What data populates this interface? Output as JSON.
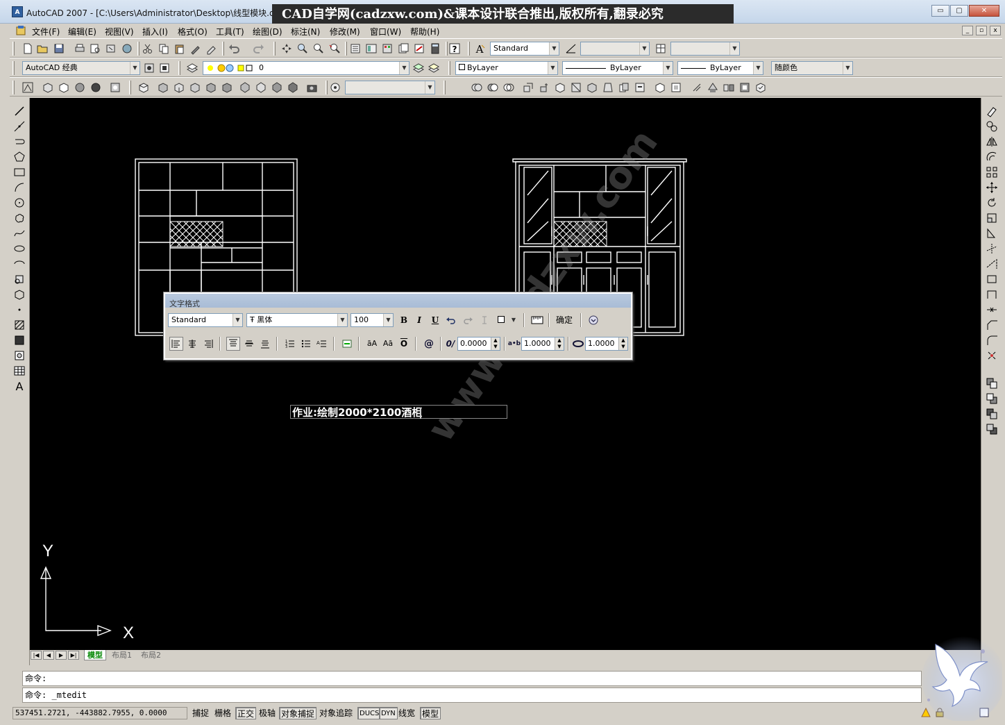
{
  "window": {
    "title": "AutoCAD 2007 - [C:\\Users\\Administrator\\Desktop\\线型模块.d",
    "icon_label": "A",
    "watermark_banner": "CAD自学网(cadzxw.com)&课本设计联合推出,版权所有,翻录必究",
    "min_label": "▭",
    "max_label": "▢",
    "close_label": "✕"
  },
  "menu": {
    "items": [
      "文件(F)",
      "编辑(E)",
      "视图(V)",
      "插入(I)",
      "格式(O)",
      "工具(T)",
      "绘图(D)",
      "标注(N)",
      "修改(M)",
      "窗口(W)",
      "帮助(H)"
    ],
    "mdi_min": "_",
    "mdi_max": "▫",
    "mdi_close": "x"
  },
  "toolbars": {
    "text_style": "Standard",
    "workspace": "AutoCAD 经典",
    "layer": "0",
    "color": "ByLayer",
    "linetype": "ByLayer",
    "lineweight": "ByLayer",
    "plotstyle": "随颜色"
  },
  "canvas": {
    "mtext": "作业:绘制2000*2100酒柜",
    "ucs_x": "X",
    "ucs_y": "Y",
    "diag_watermark": "www.cadzxw.com"
  },
  "text_formatting": {
    "title": "文字格式",
    "style": "Standard",
    "font": "黑体",
    "font_prefix": "Ŧ",
    "height": "100",
    "bold": "B",
    "italic": "I",
    "underline": "U",
    "ok": "确定",
    "oblique": "0.0000",
    "tracking": "1.0000",
    "width_factor": "1.0000",
    "symbol": "@",
    "upper_label": "āA",
    "lower_label": "Aā",
    "overline_label": "O",
    "oblique_icon": "0/",
    "tracking_icon": "a•b"
  },
  "tabs": {
    "model": "模型",
    "layout1": "布局1",
    "layout2": "布局2"
  },
  "command": {
    "line1": "命令:",
    "line2": "命令: _mtedit"
  },
  "status": {
    "coords": "537451.2721, -443882.7955, 0.0000",
    "toggles": [
      "捕捉",
      "栅格",
      "正交",
      "极轴",
      "对象捕捉",
      "对象追踪",
      "DUCS",
      "DYN",
      "线宽",
      "模型"
    ]
  }
}
